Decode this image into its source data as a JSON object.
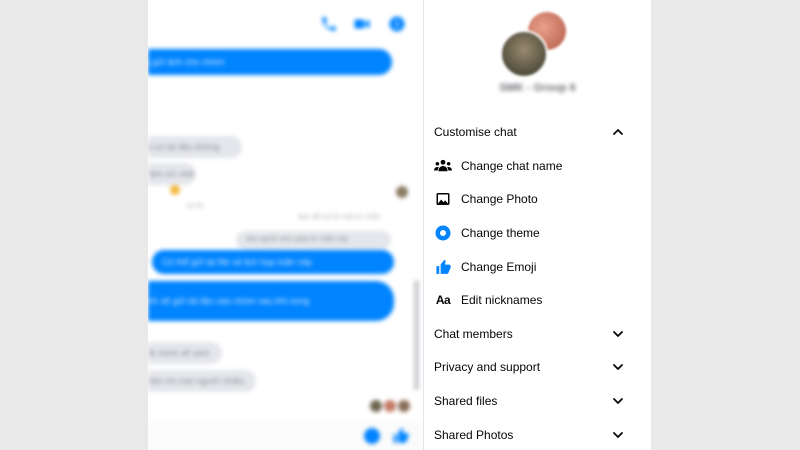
{
  "chat": {
    "messages": [
      {
        "dir": "out",
        "text": "Đã gửi ảnh cho nhóm"
      },
      {
        "dir": "in",
        "text": "Ai có tài liệu không"
      },
      {
        "dir": "in",
        "text": "Cảm ơn nhé"
      },
      {
        "dir": "in",
        "text": "10:42"
      },
      {
        "dir": "meta",
        "text": "Bạn đã trả lời một tin nhắn"
      },
      {
        "dir": "meta",
        "text": "Mọi người xem giúp tin nhắn này"
      },
      {
        "dir": "out",
        "text": "Có thể gửi lại file và lịch họp tuần này"
      },
      {
        "dir": "out",
        "text": "Mình sẽ gửi tài liệu vào nhóm sau khi xong"
      },
      {
        "dir": "out",
        "text": "ok"
      },
      {
        "dir": "in",
        "text": "Ok mình sẽ xem"
      },
      {
        "dir": "in",
        "text": "Cảm ơn mọi người nhiều"
      }
    ]
  },
  "info": {
    "group_name": "SMK - Group 6",
    "customise_header": "Customise chat",
    "menu": [
      {
        "icon": "people-icon",
        "label": "Change chat name"
      },
      {
        "icon": "photo-icon",
        "label": "Change Photo"
      },
      {
        "icon": "theme-icon",
        "label": "Change theme"
      },
      {
        "icon": "thumbs-up-icon",
        "label": "Change Emoji"
      },
      {
        "icon": "Aa",
        "label": "Edit nicknames"
      }
    ],
    "sections": [
      {
        "label": "Chat members"
      },
      {
        "label": "Privacy and support"
      },
      {
        "label": "Shared files"
      },
      {
        "label": "Shared Photos"
      }
    ]
  },
  "colors": {
    "accent": "#0084ff",
    "incoming_bubble": "#e4e6eb",
    "text": "#050505"
  }
}
